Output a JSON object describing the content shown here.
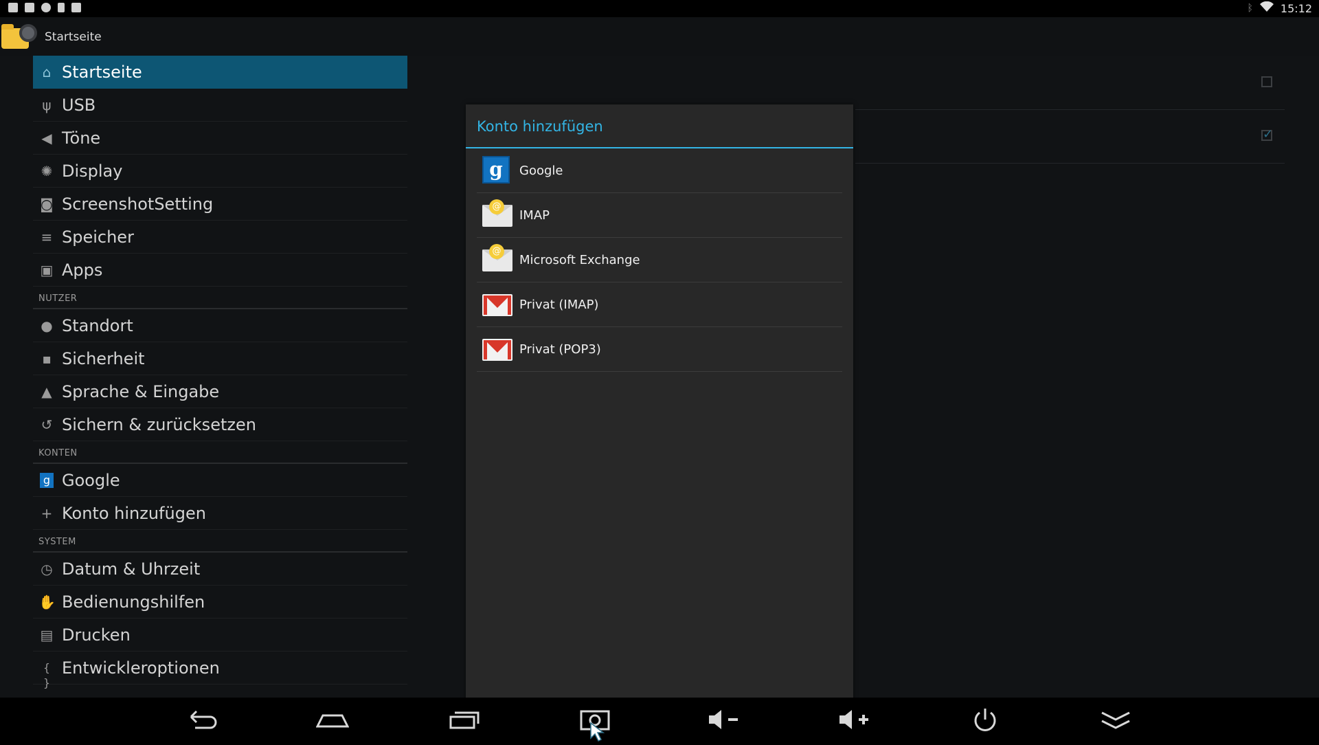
{
  "status_bar": {
    "left_icons": [
      "gallery-icon",
      "gamepad-icon",
      "circle-icon",
      "sdcard-icon",
      "briefcase-icon"
    ],
    "right_icons": [
      "bluetooth-icon",
      "wifi-icon"
    ],
    "time": "15:12"
  },
  "action_bar": {
    "title": "Startseite",
    "icon": "settings-folder-icon"
  },
  "sidebar": {
    "sections": [
      {
        "header": "",
        "items": [
          {
            "label": "Startseite",
            "icon": "home-icon",
            "active": true
          },
          {
            "label": "USB",
            "icon": "usb-icon"
          },
          {
            "label": "Töne",
            "icon": "sound-icon"
          },
          {
            "label": "Display",
            "icon": "brightness-icon"
          },
          {
            "label": "ScreenshotSetting",
            "icon": "camera-icon"
          },
          {
            "label": "Speicher",
            "icon": "storage-icon"
          },
          {
            "label": "Apps",
            "icon": "apps-icon"
          }
        ]
      },
      {
        "header": "NUTZER",
        "items": [
          {
            "label": "Standort",
            "icon": "location-icon"
          },
          {
            "label": "Sicherheit",
            "icon": "lock-icon"
          },
          {
            "label": "Sprache & Eingabe",
            "icon": "language-icon"
          },
          {
            "label": "Sichern & zurücksetzen",
            "icon": "backup-icon"
          }
        ]
      },
      {
        "header": "KONTEN",
        "items": [
          {
            "label": "Google",
            "icon": "google-icon"
          },
          {
            "label": "Konto hinzufügen",
            "icon": "plus-icon"
          }
        ]
      },
      {
        "header": "SYSTEM",
        "items": [
          {
            "label": "Datum & Uhrzeit",
            "icon": "clock-icon"
          },
          {
            "label": "Bedienungshilfen",
            "icon": "hand-icon"
          },
          {
            "label": "Drucken",
            "icon": "printer-icon"
          },
          {
            "label": "Entwickleroptionen",
            "icon": "braces-icon"
          }
        ]
      }
    ]
  },
  "background_pane": {
    "checkbox_1_checked": false,
    "checkbox_2_checked": true
  },
  "dialog": {
    "title": "Konto hinzufügen",
    "items": [
      {
        "label": "Google",
        "icon": "google-icon"
      },
      {
        "label": "IMAP",
        "icon": "email-icon"
      },
      {
        "label": "Microsoft Exchange",
        "icon": "email-icon"
      },
      {
        "label": "Privat (IMAP)",
        "icon": "gmail-icon"
      },
      {
        "label": "Privat (POP3)",
        "icon": "gmail-icon"
      }
    ]
  },
  "nav_bar": {
    "buttons": [
      "back-icon",
      "home-icon",
      "recents-icon",
      "screenshot-icon",
      "volume-down-icon",
      "volume-up-icon",
      "power-icon",
      "hide-bar-icon"
    ]
  },
  "colors": {
    "accent": "#33b5e5",
    "active_item": "#0d5674",
    "background": "#111315",
    "dialog": "#282828"
  }
}
